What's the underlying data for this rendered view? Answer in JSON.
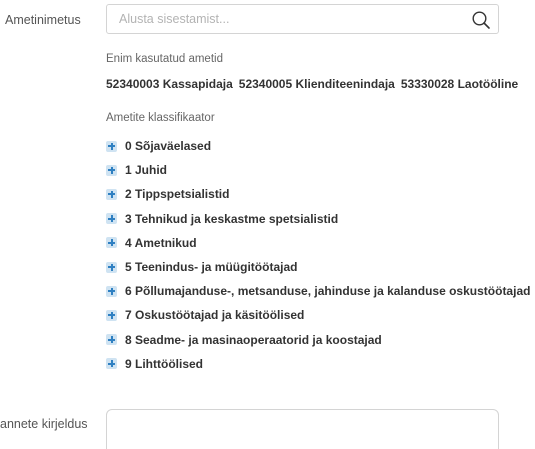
{
  "occupation_field": {
    "label": "Ametinimetus",
    "placeholder": "Alusta sisestamist...",
    "value": ""
  },
  "popular": {
    "heading": "Enim kasutatud ametid",
    "items": [
      "52340003 Kassapidaja",
      "52340005 Klienditeenindaja",
      "53330028 Laotööline"
    ]
  },
  "classifier": {
    "heading": "Ametite klassifikaator",
    "items": [
      "0 Sõjaväelased",
      "1 Juhid",
      "2 Tippspetsialistid",
      "3 Tehnikud ja keskastme spetsialistid",
      "4 Ametnikud",
      "5 Teenindus- ja müügitöötajad",
      "6 Põllumajanduse-, metsanduse, jahinduse ja kalanduse oskustöötajad",
      "7 Oskustöötajad ja käsitöölised",
      "8 Seadme- ja masinaoperaatorid ja koostajad",
      "9 Lihttöölised"
    ]
  },
  "description_field": {
    "label": "annete kirjeldus",
    "value": ""
  },
  "colors": {
    "icon_bg": "#cfe3f2",
    "icon_fg": "#2f80c2",
    "border": "#d4d4d4"
  }
}
